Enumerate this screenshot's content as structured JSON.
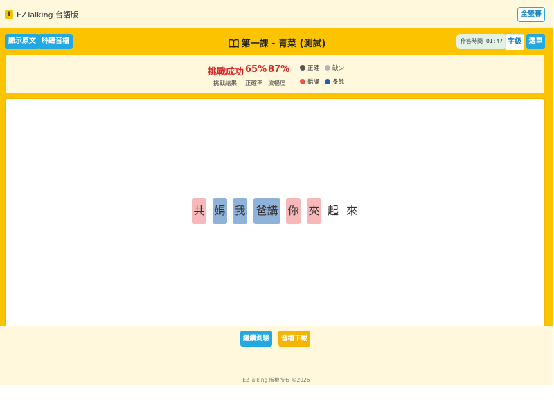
{
  "app": {
    "logo_glyph": "I",
    "name": "EZTalking 台語版",
    "fullscreen_label": "全螢幕"
  },
  "toolbar": {
    "show_original_label": "顯示原文",
    "listen_audio_label": "聆聽音檔",
    "title": "第一課 - 青菜 (測試)",
    "timer_label": "作答時間",
    "timer_value": "01:47",
    "font_size_label": "字級",
    "menu_label": "選單"
  },
  "result": {
    "outcome": "挑戰成功",
    "outcome_label": "挑戰結果",
    "accuracy": "65%",
    "accuracy_label": "正確率",
    "fluency": "87%",
    "fluency_label": "流暢度"
  },
  "legend": [
    {
      "label": "正確",
      "color": "#555555",
      "icon": "dot"
    },
    {
      "label": "缺少",
      "color": "#b5b5b5",
      "icon": "dot"
    },
    {
      "label": "錯誤",
      "color": "#ef5350",
      "icon": "dot"
    },
    {
      "label": "多餘",
      "color": "#1e5fb3",
      "icon": "dot"
    }
  ],
  "words": [
    {
      "text": "共",
      "status": "error"
    },
    {
      "text": "媽",
      "status": "extra"
    },
    {
      "text": "我",
      "status": "extra"
    },
    {
      "text": "爸講",
      "status": "extra"
    },
    {
      "text": "你",
      "status": "error"
    },
    {
      "text": "夾",
      "status": "error"
    },
    {
      "text": "起",
      "status": "correct"
    },
    {
      "text": "來",
      "status": "correct"
    }
  ],
  "actions": {
    "continue_label": "繼續測驗",
    "download_label": "音檔下載"
  },
  "footer": {
    "copyright": "EZTalking 版權所有 ©2026"
  },
  "colors": {
    "primary": "#23a9e1",
    "band": "#fcc300",
    "cream": "#fff8dc",
    "success": "#d62b2b",
    "download": "#f5b400"
  }
}
